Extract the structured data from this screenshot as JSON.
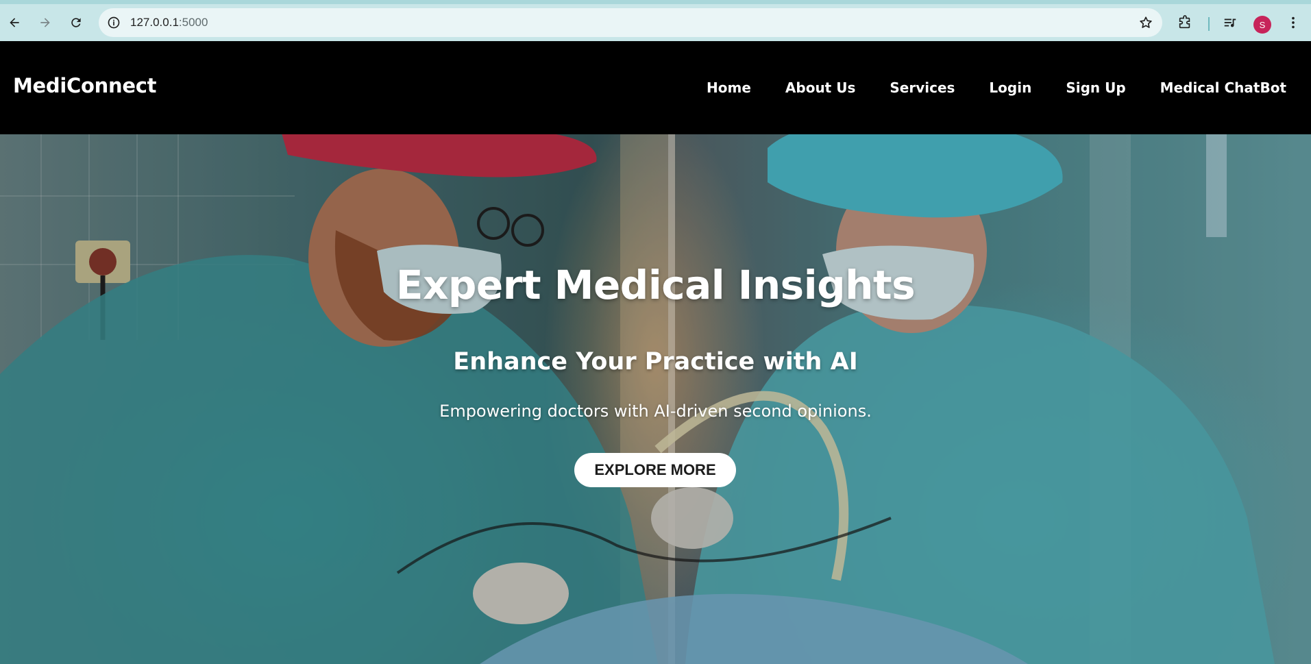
{
  "browser": {
    "url_host": "127.0.0.1",
    "url_port": ":5000",
    "profile_initial": "S",
    "icons": [
      "back-arrow-icon",
      "forward-arrow-icon",
      "reload-icon",
      "site-info-icon",
      "bookmark-star-icon",
      "extensions-puzzle-icon",
      "media-controls-icon",
      "more-vert-icon"
    ]
  },
  "header": {
    "brand": "MediConnect",
    "nav": [
      {
        "label": "Home"
      },
      {
        "label": "About Us"
      },
      {
        "label": "Services"
      },
      {
        "label": "Login"
      },
      {
        "label": "Sign Up"
      },
      {
        "label": "Medical ChatBot"
      }
    ]
  },
  "hero": {
    "title": "Expert Medical Insights",
    "subtitle": "Enhance Your Practice with AI",
    "tagline": "Empowering doctors with AI-driven second opinions.",
    "cta_label": "EXPLORE MORE"
  },
  "colors": {
    "chrome_bg": "#c8e6e8",
    "header_bg": "#000000",
    "profile_avatar": "#c7245a",
    "cta_bg": "#ffffff"
  }
}
